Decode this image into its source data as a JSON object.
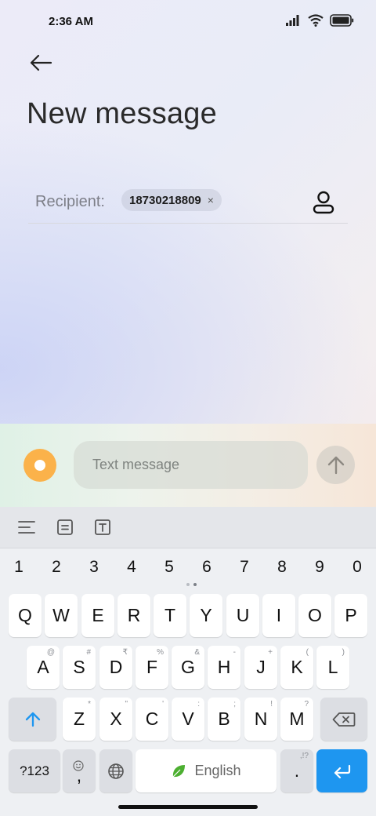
{
  "status_bar": {
    "time": "2:36 AM"
  },
  "header": {
    "title": "New message"
  },
  "recipient": {
    "label": "Recipient:",
    "chip_number": "18730218809",
    "chip_remove": "×"
  },
  "compose": {
    "placeholder": "Text message"
  },
  "keyboard": {
    "number_row": [
      "1",
      "2",
      "3",
      "4",
      "5",
      "6",
      "7",
      "8",
      "9",
      "0"
    ],
    "row1": [
      {
        "label": "Q"
      },
      {
        "label": "W"
      },
      {
        "label": "E"
      },
      {
        "label": "R"
      },
      {
        "label": "T"
      },
      {
        "label": "Y"
      },
      {
        "label": "U"
      },
      {
        "label": "I"
      },
      {
        "label": "O"
      },
      {
        "label": "P"
      }
    ],
    "row2": [
      {
        "label": "A",
        "hint": "@"
      },
      {
        "label": "S",
        "hint": "#"
      },
      {
        "label": "D",
        "hint": "₹"
      },
      {
        "label": "F",
        "hint": "%"
      },
      {
        "label": "G",
        "hint": "&"
      },
      {
        "label": "H",
        "hint": "-"
      },
      {
        "label": "J",
        "hint": "+"
      },
      {
        "label": "K",
        "hint": "("
      },
      {
        "label": "L",
        "hint": ")"
      }
    ],
    "row3": [
      {
        "label": "Z",
        "hint": "*"
      },
      {
        "label": "X",
        "hint": "\""
      },
      {
        "label": "C",
        "hint": "'"
      },
      {
        "label": "V",
        "hint": ":"
      },
      {
        "label": "B",
        "hint": ";"
      },
      {
        "label": "N",
        "hint": "!"
      },
      {
        "label": "M",
        "hint": "?"
      }
    ],
    "symbols_label": "?123",
    "comma_label": ",",
    "space_label": "English",
    "period_label": ".",
    "period_hint": ",!?"
  },
  "colors": {
    "accent": "#1e96f0",
    "attach": "#fbb24a"
  }
}
